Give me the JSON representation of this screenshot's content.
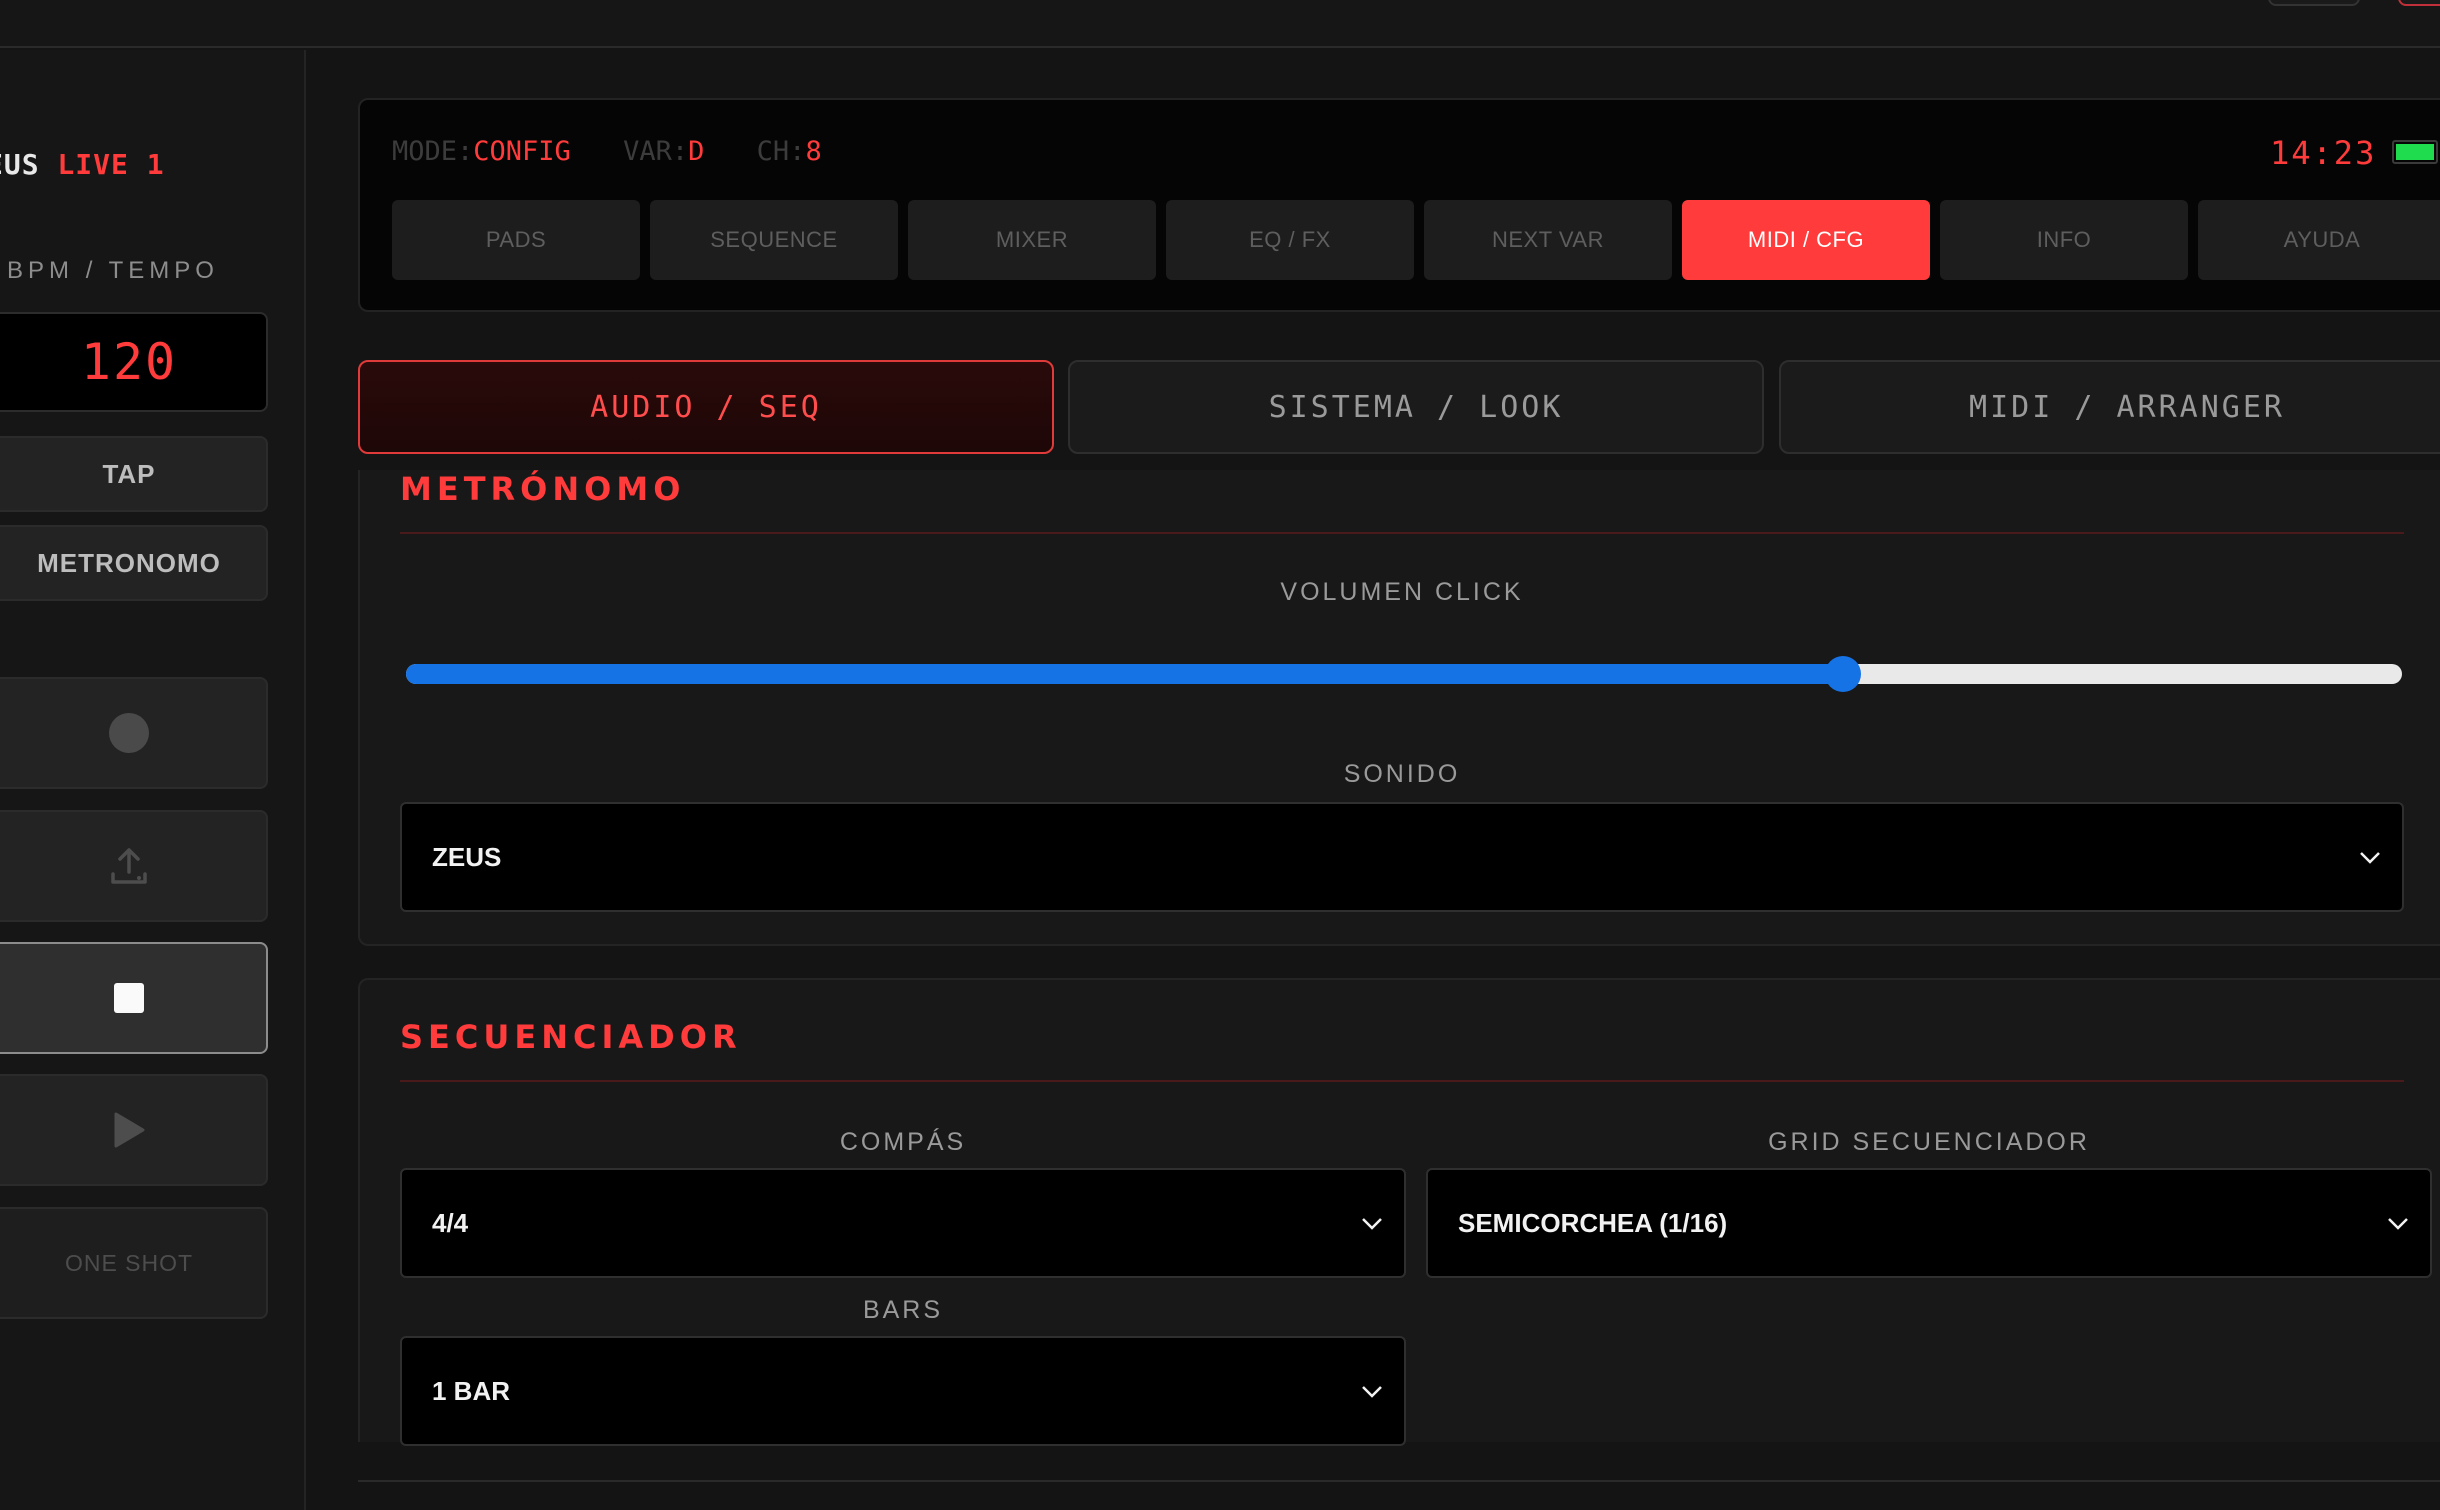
{
  "brand": {
    "part1": "EUS",
    "part2": "LIVE 1"
  },
  "sidebar": {
    "bpm_label": "BPM / TEMPO",
    "bpm_value": "120",
    "tap_label": "TAP",
    "metronome_label": "METRONOMO",
    "oneshot_label": "ONE SHOT"
  },
  "header": {
    "mode_key": "MODE:",
    "mode_value": "CONFIG",
    "var_key": "VAR:",
    "var_value": "D",
    "ch_key": "CH:",
    "ch_value": "8",
    "clock": "14:23",
    "tabs": [
      {
        "label": "PADS"
      },
      {
        "label": "SEQUENCE"
      },
      {
        "label": "MIXER"
      },
      {
        "label": "EQ / FX"
      },
      {
        "label": "NEXT VAR"
      },
      {
        "label": "MIDI / CFG",
        "active": true
      },
      {
        "label": "INFO"
      },
      {
        "label": "AYUDA"
      }
    ]
  },
  "subtabs": [
    {
      "label": "AUDIO / SEQ",
      "active": true
    },
    {
      "label": "SISTEMA / LOOK"
    },
    {
      "label": "MIDI / ARRANGER"
    }
  ],
  "metronome": {
    "title": "METRÓNOMO",
    "volume_label": "VOLUMEN CLICK",
    "volume_value": 0.72,
    "sound_label": "SONIDO",
    "sound_value": "ZEUS"
  },
  "sequencer": {
    "title": "SECUENCIADOR",
    "compas_label": "COMPÁS",
    "compas_value": "4/4",
    "grid_label": "GRID SECUENCIADOR",
    "grid_value": "SEMICORCHEA (1/16)",
    "bars_label": "BARS",
    "bars_value": "1 BAR"
  },
  "colors": {
    "accent": "#ff3b3b",
    "slider": "#1673e6",
    "battery": "#1fdc4f"
  }
}
